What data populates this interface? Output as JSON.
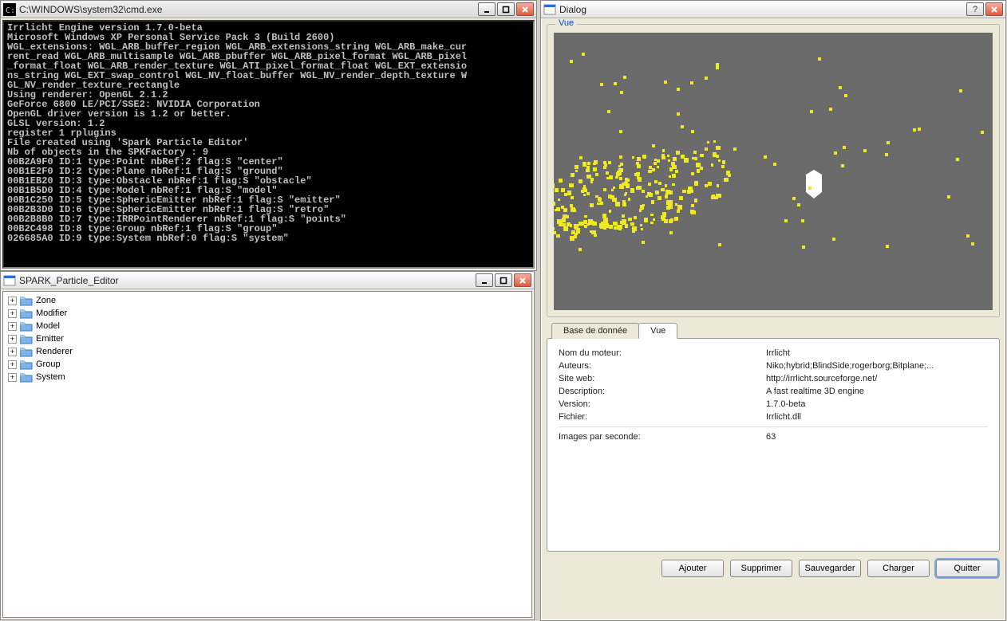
{
  "cmd": {
    "title": "C:\\WINDOWS\\system32\\cmd.exe",
    "text": "Irrlicht Engine version 1.7.0-beta\nMicrosoft Windows XP Personal Service Pack 3 (Build 2600)\nWGL_extensions: WGL_ARB_buffer_region WGL_ARB_extensions_string WGL_ARB_make_cur\nrent_read WGL_ARB_multisample WGL_ARB_pbuffer WGL_ARB_pixel_format WGL_ARB_pixel\n_format_float WGL_ARB_render_texture WGL_ATI_pixel_format_float WGL_EXT_extensio\nns_string WGL_EXT_swap_control WGL_NV_float_buffer WGL_NV_render_depth_texture W\nGL_NV_render_texture_rectangle\nUsing renderer: OpenGL 2.1.2\nGeForce 6800 LE/PCI/SSE2: NVIDIA Corporation\nOpenGL driver version is 1.2 or better.\nGLSL version: 1.2\nregister 1 rplugins\nFile created using 'Spark Particle Editor'\nNb of objects in the SPKFactory : 9\n00B2A9F0 ID:1 type:Point nbRef:2 flag:S \"center\"\n00B1E2F0 ID:2 type:Plane nbRef:1 flag:S \"ground\"\n00B1EB20 ID:3 type:Obstacle nbRef:1 flag:S \"obstacle\"\n00B1B5D0 ID:4 type:Model nbRef:1 flag:S \"model\"\n00B1C250 ID:5 type:SphericEmitter nbRef:1 flag:S \"emitter\"\n00B2B3D0 ID:6 type:SphericEmitter nbRef:1 flag:S \"retro\"\n00B2B8B0 ID:7 type:IRRPointRenderer nbRef:1 flag:S \"points\"\n00B2C498 ID:8 type:Group nbRef:1 flag:S \"group\"\n026685A0 ID:9 type:System nbRef:0 flag:S \"system\""
  },
  "editor": {
    "title": "SPARK_Particle_Editor",
    "items": [
      "Zone",
      "Modifier",
      "Model",
      "Emitter",
      "Renderer",
      "Group",
      "System"
    ]
  },
  "dialog": {
    "title": "Dialog",
    "vueLabel": "Vue",
    "tabs": {
      "database": "Base de donnée",
      "vue": "Vue"
    },
    "info": {
      "engine_name_label": "Nom du moteur:",
      "engine_name": "Irrlicht",
      "authors_label": "Auteurs:",
      "authors": "Niko;hybrid;BlindSide;rogerborg;Bitplane;...",
      "website_label": "Site web:",
      "website": "http://irrlicht.sourceforge.net/",
      "description_label": "Description:",
      "description": "A fast realtime 3D engine",
      "version_label": "Version:",
      "version": "1.7.0-beta",
      "file_label": "Fichier:",
      "file": "Irrlicht.dll",
      "fps_label": "Images par seconde:",
      "fps": "63"
    },
    "buttons": {
      "add": "Ajouter",
      "delete": "Supprimer",
      "save": "Sauvegarder",
      "load": "Charger",
      "quit": "Quitter"
    }
  }
}
